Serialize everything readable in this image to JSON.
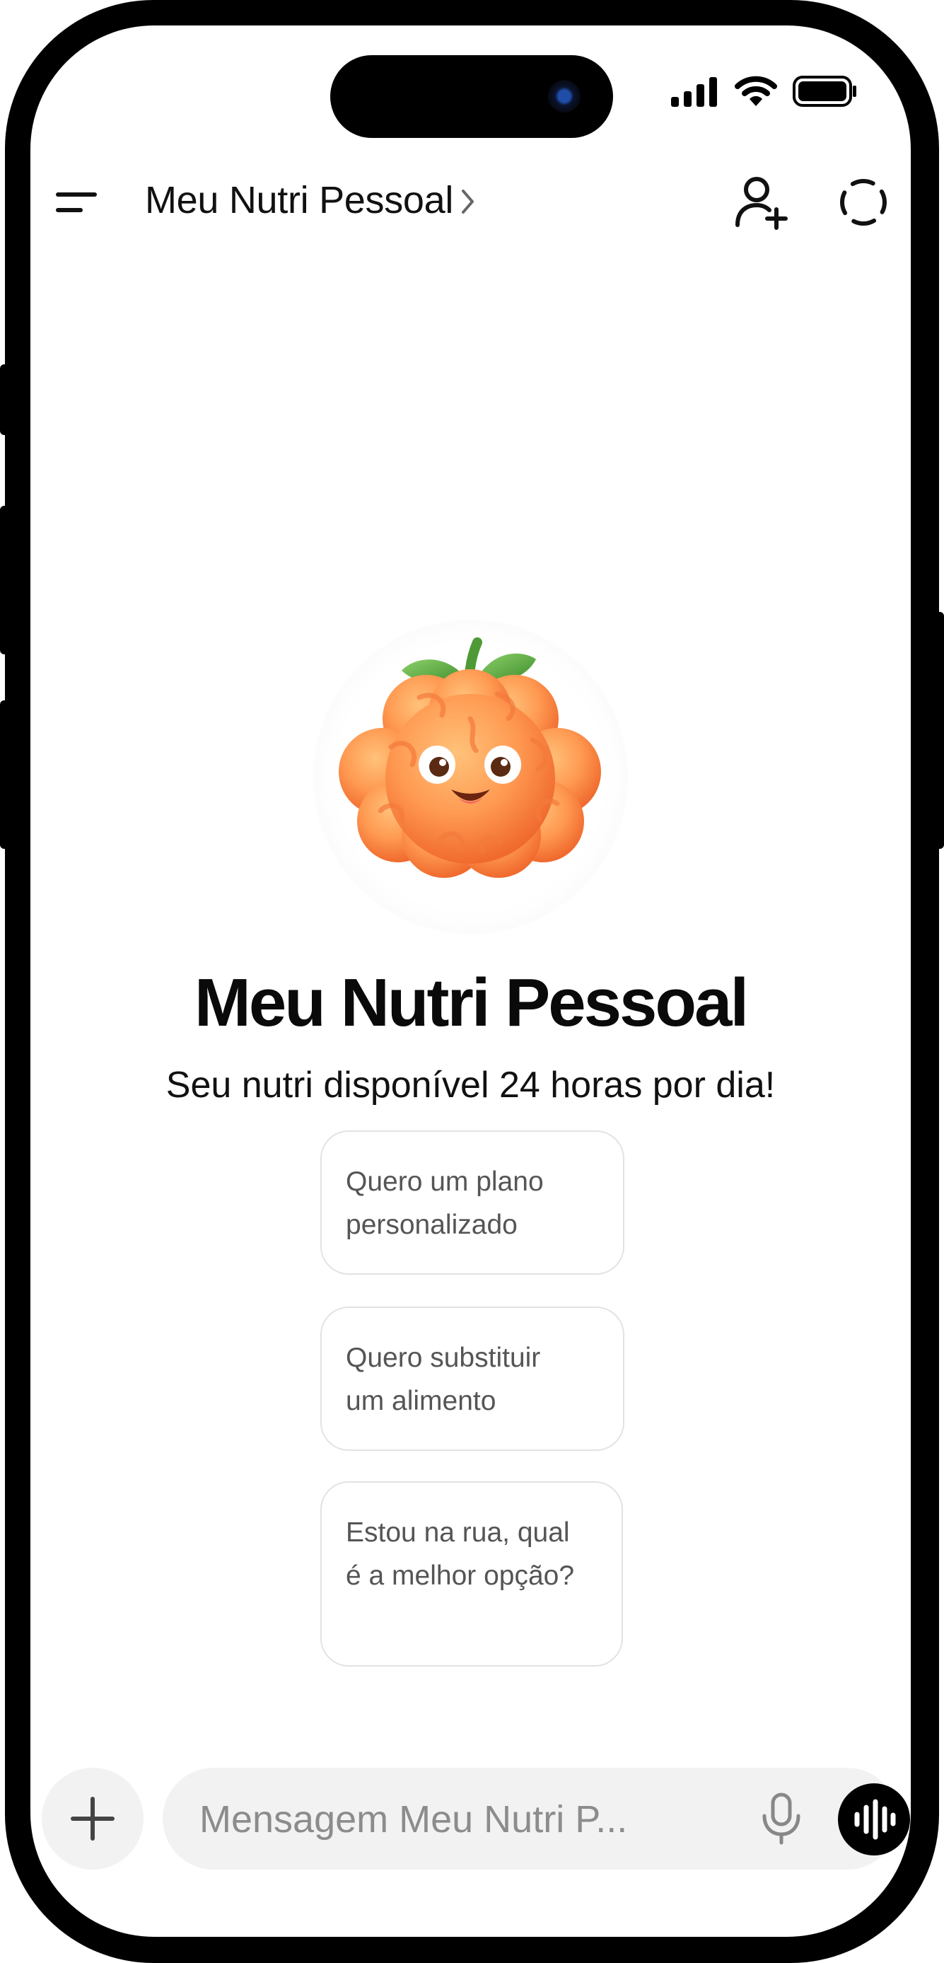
{
  "header": {
    "title": "Meu Nutri Pessoal"
  },
  "hero": {
    "title": "Meu Nutri Pessoal",
    "subtitle": "Seu nutri disponível 24 horas por dia!"
  },
  "suggestions": [
    {
      "line1": "Quero um plano",
      "line2": "personalizado"
    },
    {
      "line1": "Quero substituir",
      "line2": "um alimento"
    },
    {
      "line1": "Estou na rua, qual",
      "line2": "é a melhor opção?"
    }
  ],
  "composer": {
    "placeholder": "Mensagem Meu Nutri P..."
  },
  "icons": {
    "menu": "menu-icon",
    "chevron": "chevron-right-icon",
    "add_person": "add-person-icon",
    "new_chat": "dashed-circle-icon",
    "plus": "plus-icon",
    "mic": "microphone-icon",
    "voice": "voice-waveform-icon"
  },
  "colors": {
    "accent": "#000000",
    "mascot": "#FF8A4C",
    "leaf": "#6BB04A"
  }
}
